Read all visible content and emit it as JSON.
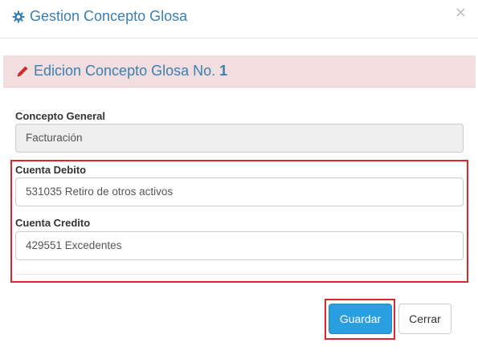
{
  "header": {
    "icon": "gear-icon",
    "title": "Gestion Concepto Glosa",
    "close_label": "×"
  },
  "banner": {
    "icon": "pencil-icon",
    "text": "Edicion Concepto Glosa No.",
    "number": "1"
  },
  "form": {
    "concepto_general": {
      "label": "Concepto General",
      "value": "Facturación"
    },
    "cuenta_debito": {
      "label": "Cuenta Debito",
      "value": "531035 Retiro de otros activos"
    },
    "cuenta_credito": {
      "label": "Cuenta Credito",
      "value": "429551 Excedentes"
    }
  },
  "footer": {
    "save_label": "Guardar",
    "close_label": "Cerrar"
  },
  "colors": {
    "accent": "#3c7fb1",
    "banner_bg": "#f2dede",
    "highlight": "#d9272e",
    "primary_button": "#2a9fe0"
  }
}
